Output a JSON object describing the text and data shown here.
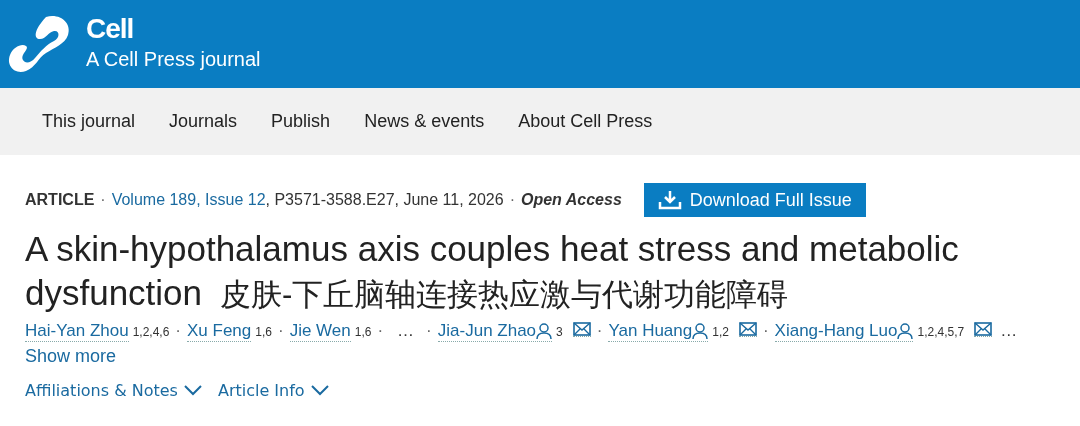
{
  "header": {
    "title": "Cell",
    "subtitle": "A Cell Press journal"
  },
  "nav": [
    "This journal",
    "Journals",
    "Publish",
    "News & events",
    "About Cell Press"
  ],
  "meta": {
    "type": "ARTICLE",
    "sep1": "·",
    "issue_link": "Volume 189, Issue 12",
    "details": ", P3571-3588.E27, June 11, 2026",
    "sep2": "·",
    "access": "Open Access"
  },
  "download_button": "Download Full Issue",
  "title": {
    "english": "A skin-hypothalamus axis couples heat stress and metabolic dysfunction",
    "chinese": "皮肤-下丘脑轴连接热应激与代谢功能障碍"
  },
  "authors": [
    {
      "kind": "author",
      "name": "Hai-Yan Zhou",
      "sup": "1,2,4,6",
      "corresponding": false,
      "email": false
    },
    {
      "kind": "sep",
      "text": "·"
    },
    {
      "kind": "author",
      "name": "Xu Feng",
      "sup": "1,6",
      "corresponding": false,
      "email": false
    },
    {
      "kind": "sep",
      "text": "·"
    },
    {
      "kind": "author",
      "name": "Jie Wen",
      "sup": "1,6",
      "corresponding": false,
      "email": false
    },
    {
      "kind": "sep",
      "text": "·"
    },
    {
      "kind": "more",
      "text": "…"
    },
    {
      "kind": "sep",
      "text": "·"
    },
    {
      "kind": "author",
      "name": "Jia-Jun Zhao",
      "sup": "3",
      "corresponding": true,
      "email": true
    },
    {
      "kind": "sep",
      "text": "·"
    },
    {
      "kind": "author",
      "name": "Yan Huang",
      "sup": "1,2",
      "corresponding": true,
      "email": true
    },
    {
      "kind": "sep",
      "text": "·"
    },
    {
      "kind": "author",
      "name": "Xiang-Hang Luo",
      "sup": "1,2,4,5,7",
      "corresponding": true,
      "email": true
    },
    {
      "kind": "more",
      "text": "…"
    }
  ],
  "show_more": "Show more",
  "sections": [
    {
      "label": "Affiliations & Notes",
      "expanded": false
    },
    {
      "label": "Article Info",
      "expanded": false
    }
  ]
}
